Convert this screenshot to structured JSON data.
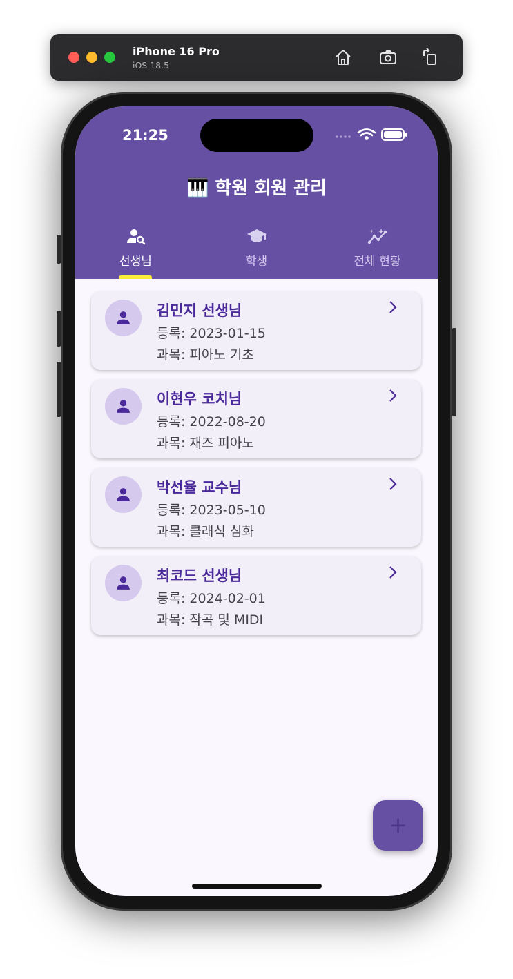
{
  "simulator": {
    "device_name": "iPhone 16 Pro",
    "os_version": "iOS 18.5",
    "buttons": [
      "home-icon",
      "screenshot-icon",
      "rotate-icon"
    ]
  },
  "status_bar": {
    "time": "21:25"
  },
  "app": {
    "title": "🎹 학원 회원 관리",
    "tabs": [
      {
        "label": "선생님",
        "icon": "person-search-icon",
        "active": true
      },
      {
        "label": "학생",
        "icon": "graduation-cap-icon",
        "active": false
      },
      {
        "label": "전체 현황",
        "icon": "insights-icon",
        "active": false
      }
    ],
    "teachers": [
      {
        "name": "김민지 선생님",
        "registered": "등록: 2023-01-15",
        "subject": "과목: 피아노 기초"
      },
      {
        "name": "이현우 코치님",
        "registered": "등록: 2022-08-20",
        "subject": "과목: 재즈 피아노"
      },
      {
        "name": "박선율 교수님",
        "registered": "등록: 2023-05-10",
        "subject": "과목: 클래식 심화"
      },
      {
        "name": "최코드 선생님",
        "registered": "등록: 2024-02-01",
        "subject": "과목: 작곡 및 MIDI"
      }
    ],
    "fab_label": "+"
  },
  "colors": {
    "appbar": "#6650a4",
    "indicator": "#ffeb3b",
    "card_bg": "#f3eff8",
    "name_text": "#4a2a9a",
    "background": "#fbf7fe"
  }
}
